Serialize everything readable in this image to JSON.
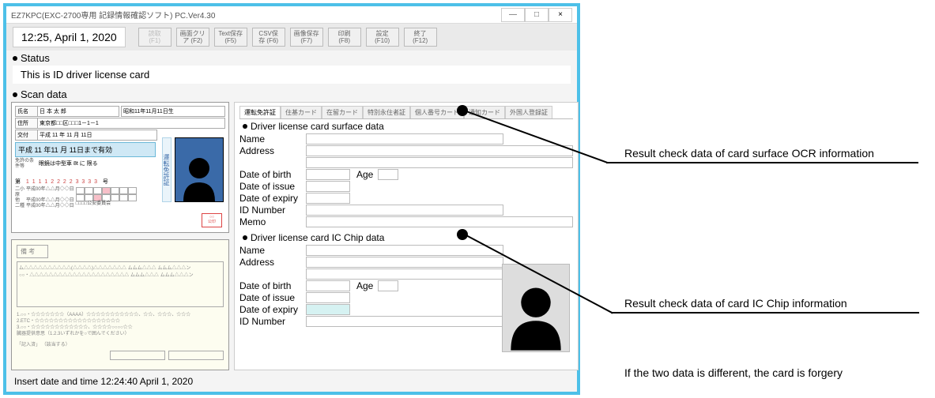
{
  "window": {
    "title": "EZ7KPC(EXC-2700専用 記録情報確認ソフト) PC.Ver4.30",
    "minimize": "—",
    "maximize": "□",
    "close": "×"
  },
  "time": "12:25,  April 1, 2020",
  "toolbar": {
    "b1": "読取 (F1)",
    "b2": "画面クリア (F2)",
    "b3": "Text保存 (F5)",
    "b4": "CSV保存 (F6)",
    "b5": "画像保存 (F7)",
    "b6": "印刷 (F8)",
    "b7": "設定 (F10)",
    "b8": "終了 (F12)"
  },
  "labels": {
    "status": "Status",
    "status_text": "This is ID driver license card",
    "scan_data": "Scan data"
  },
  "card_front": {
    "name_label": "氏名",
    "name_val": "日 本 太 郎",
    "birth_label": "昭和11年11月11日生",
    "addr_label": "住所",
    "addr_val": "東京都□□区□□□1－1－1",
    "date1_label": "交付",
    "date1_val": "平成 11 年 11 月 11日",
    "valid": "平成 11 年11 月 11日まで有効",
    "cond_label": "免許の条件等",
    "cond_val": "眼鏡は中型車 8t に 限る",
    "vert": "運転免許証",
    "num_label": "第",
    "num_val": "1 1 1 1 2 2 2 2 3 3 3 3",
    "num_suffix": "号",
    "line1": "平成00年△△月◇◇日",
    "line2": "平成00年△△月◇◇日",
    "line3": "平成00年△△月◇◇日",
    "small1": "二小原",
    "small2": "他",
    "small3": "二種",
    "org": "□□□□公安委員会"
  },
  "card_back": {
    "title": "備 考",
    "fine1": "1.○○・☆☆☆☆☆☆☆（AAAA）☆☆☆☆☆☆☆☆☆☆☆、☆☆、☆☆☆、☆☆☆",
    "fine2": "2.ETC・☆☆☆☆☆☆☆☆☆☆☆☆☆☆☆☆☆☆",
    "fine3": "3.○○・☆☆☆☆☆☆☆☆☆☆☆☆、☆☆☆☆○○○○☆☆",
    "fine4": "臓器提供意思（1.2.3いずれかを○で囲んでください）",
    "box_label": "「記入済」  （該当する）"
  },
  "tabs": {
    "t1": "運転免許証",
    "t2": "住基カード",
    "t3": "在留カード",
    "t4": "特別永住者証",
    "t5": "個人番号カード",
    "t6": "通知カード",
    "t7": "外国人登録証"
  },
  "surface": {
    "header": "Driver license card surface data",
    "name": "Name",
    "address": "Address",
    "dob": "Date of birth",
    "age": "Age",
    "doi": "Date of issue",
    "doe": "Date of expiry",
    "idnum": "ID Number",
    "memo": "Memo"
  },
  "ic": {
    "header": "Driver license card IC Chip data",
    "name": "Name",
    "address": "Address",
    "dob": "Date of birth",
    "age": "Age",
    "doi": "Date of issue",
    "doe": "Date of expiry",
    "idnum": "ID Number"
  },
  "footer": "Insert  date and time  12:24:40 April 1, 2020",
  "annotations": {
    "a1": "Result check data of card surface OCR information",
    "a2": "Result check data of card  IC Chip  information",
    "a3": "If the two data is different, the card is forgery"
  }
}
